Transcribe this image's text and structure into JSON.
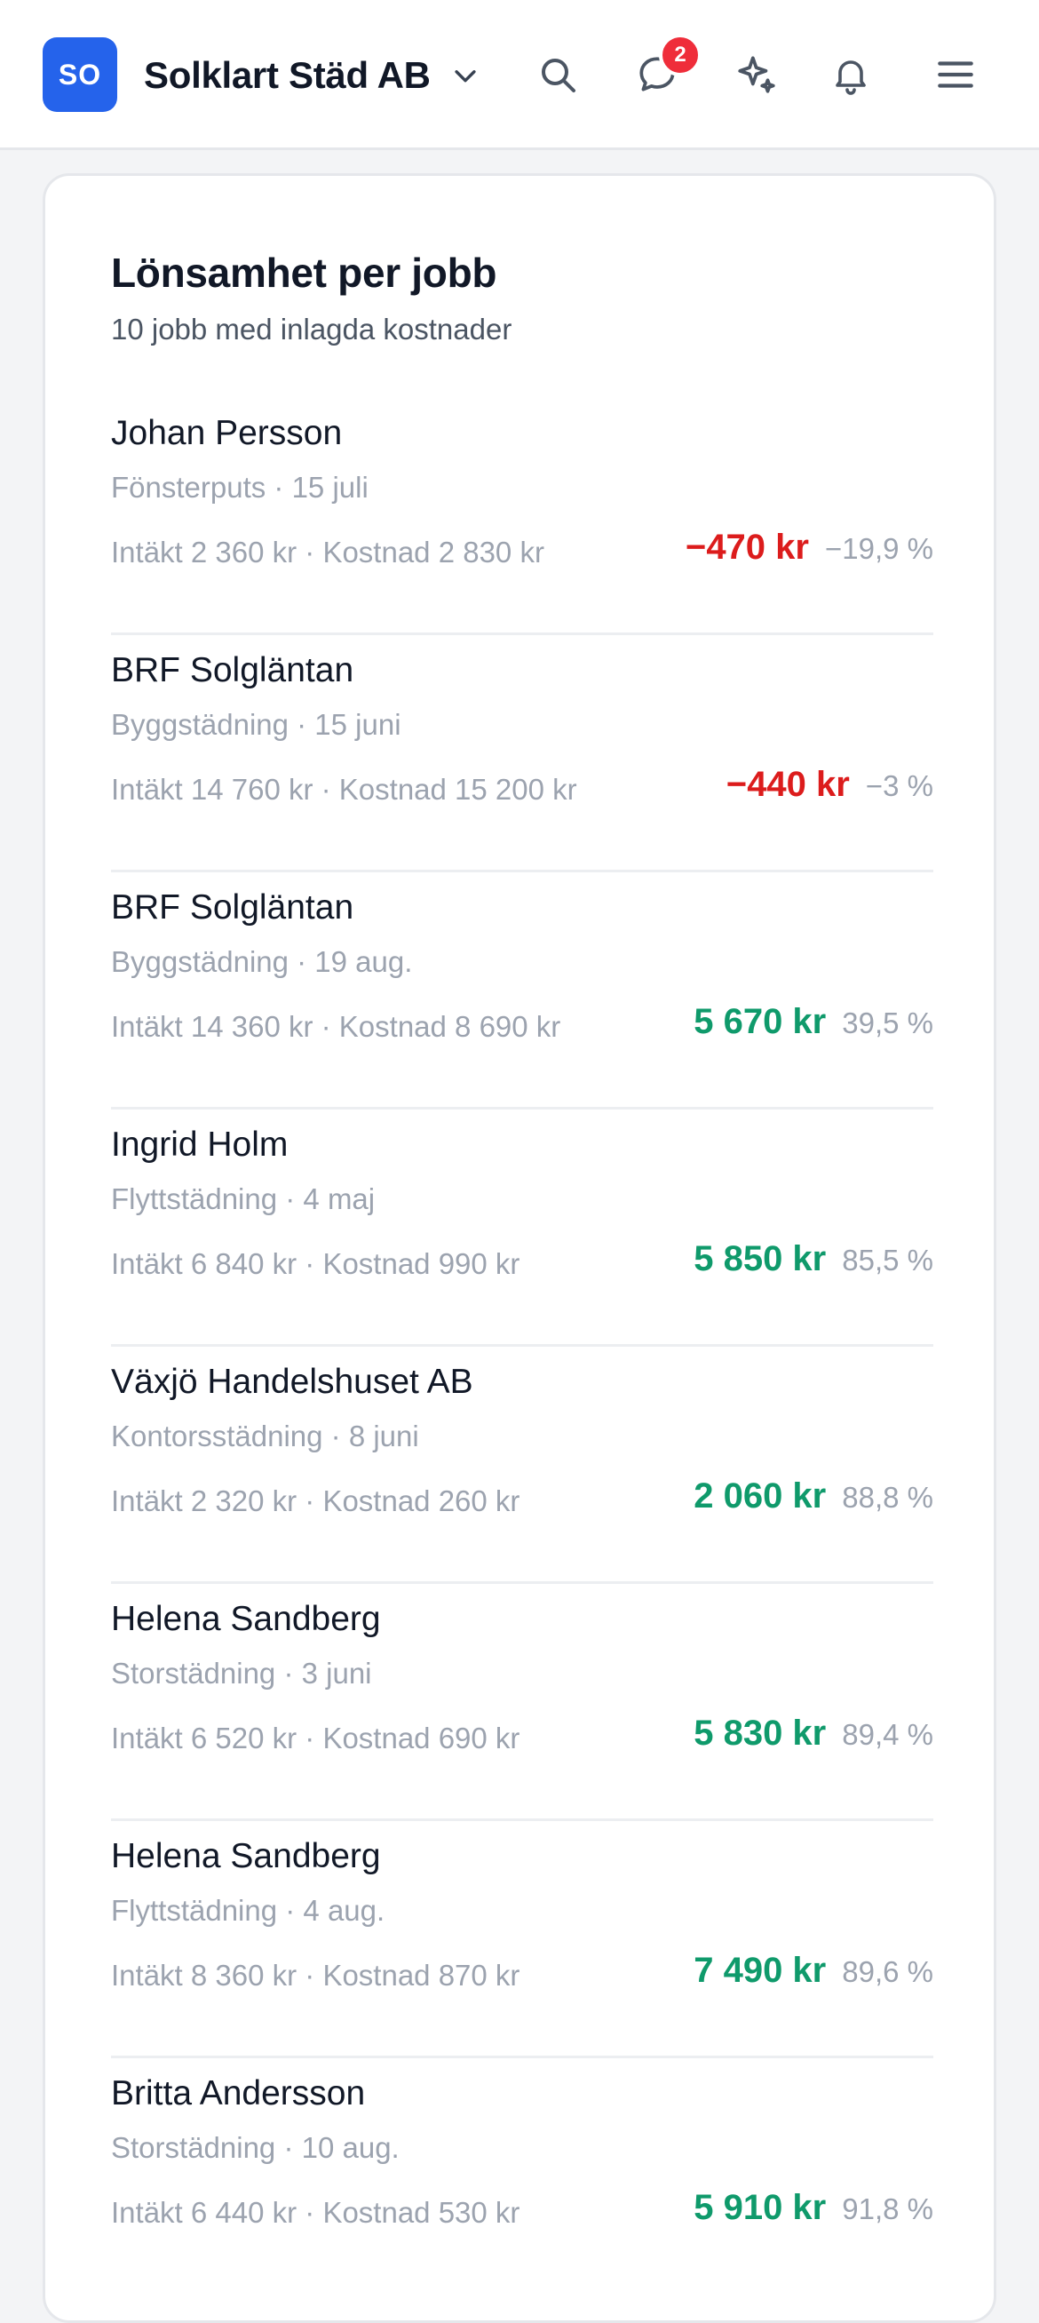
{
  "header": {
    "avatar_initials": "SO",
    "company_name": "Solklart Städ AB",
    "messages_badge": "2",
    "icons": [
      "chevron-down-icon",
      "search-icon",
      "chat-icon",
      "sparkle-icon",
      "bell-icon",
      "menu-icon"
    ],
    "accent_color": "#2563eb",
    "badge_color": "#ef2d3a"
  },
  "card": {
    "title": "Lönsamhet per jobb",
    "subtitle": "10 jobb med inlagda kostnader"
  },
  "jobs": [
    {
      "customer": "Johan Persson",
      "meta": "Fönsterputs · 15 juli",
      "finance": "Intäkt 2 360 kr · Kostnad 2 830 kr",
      "profit": "−470 kr",
      "margin": "−19,9 %",
      "status": "neg"
    },
    {
      "customer": "BRF Solgläntan",
      "meta": "Byggstädning · 15 juni",
      "finance": "Intäkt 14 760 kr · Kostnad 15 200 kr",
      "profit": "−440 kr",
      "margin": "−3 %",
      "status": "neg"
    },
    {
      "customer": "BRF Solgläntan",
      "meta": "Byggstädning · 19 aug.",
      "finance": "Intäkt 14 360 kr · Kostnad 8 690 kr",
      "profit": "5 670 kr",
      "margin": "39,5 %",
      "status": "pos"
    },
    {
      "customer": "Ingrid Holm",
      "meta": "Flyttstädning · 4 maj",
      "finance": "Intäkt 6 840 kr · Kostnad 990 kr",
      "profit": "5 850 kr",
      "margin": "85,5 %",
      "status": "pos"
    },
    {
      "customer": "Växjö Handelshuset AB",
      "meta": "Kontorsstädning · 8 juni",
      "finance": "Intäkt 2 320 kr · Kostnad 260 kr",
      "profit": "2 060 kr",
      "margin": "88,8 %",
      "status": "pos"
    },
    {
      "customer": "Helena Sandberg",
      "meta": "Storstädning · 3 juni",
      "finance": "Intäkt 6 520 kr · Kostnad 690 kr",
      "profit": "5 830 kr",
      "margin": "89,4 %",
      "status": "pos"
    },
    {
      "customer": "Helena Sandberg",
      "meta": "Flyttstädning · 4 aug.",
      "finance": "Intäkt 8 360 kr · Kostnad 870 kr",
      "profit": "7 490 kr",
      "margin": "89,6 %",
      "status": "pos"
    },
    {
      "customer": "Britta Andersson",
      "meta": "Storstädning · 10 aug.",
      "finance": "Intäkt 6 440 kr · Kostnad 530 kr",
      "profit": "5 910 kr",
      "margin": "91,8 %",
      "status": "pos"
    }
  ],
  "colors": {
    "negative": "#dc1c1c",
    "positive": "#0f9a6b"
  }
}
